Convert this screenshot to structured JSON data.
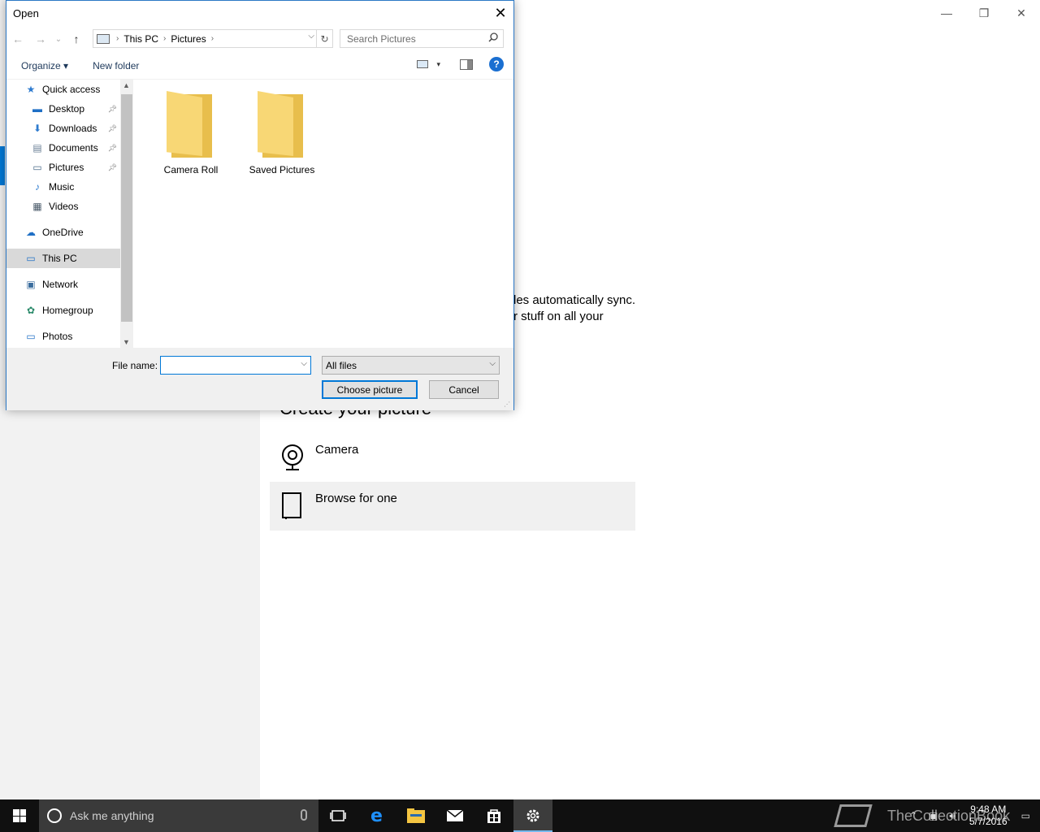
{
  "background": {
    "sync_text_line1": "les automatically sync.",
    "sync_text_line2": "r stuff on all your",
    "create_heading": "Create your picture",
    "options": [
      {
        "label": "Camera",
        "icon": "camera-icon"
      },
      {
        "label": "Browse for one",
        "icon": "browse-icon"
      }
    ],
    "window_controls": {
      "minimize": "—",
      "restore": "❐",
      "close": "✕"
    }
  },
  "dialog": {
    "title": "Open",
    "close_glyph": "✕",
    "address": {
      "crumbs": [
        "This PC",
        "Pictures"
      ],
      "separator": "›",
      "dropdown_glyph": "⌵",
      "refresh_glyph": "↻"
    },
    "search": {
      "placeholder": "Search Pictures",
      "icon": "search-icon"
    },
    "nav_buttons": {
      "back": "←",
      "forward": "→",
      "recent": "⌄",
      "up": "↑"
    },
    "toolbar": {
      "organize": "Organize ▾",
      "new_folder": "New folder",
      "view_dd": "▾",
      "help": "?"
    },
    "nav_pane": [
      {
        "label": "Quick access",
        "icon": "star-icon",
        "glyph": "★",
        "color": "#2e7bcf",
        "indent": 0,
        "pinned": false,
        "selected": false
      },
      {
        "label": "Desktop",
        "icon": "desktop-icon",
        "glyph": "▬",
        "color": "#1f6fc5",
        "indent": 1,
        "pinned": true,
        "selected": false
      },
      {
        "label": "Downloads",
        "icon": "downloads-icon",
        "glyph": "⬇",
        "color": "#2e7bcf",
        "indent": 1,
        "pinned": true,
        "selected": false
      },
      {
        "label": "Documents",
        "icon": "documents-icon",
        "glyph": "▤",
        "color": "#6a7f96",
        "indent": 1,
        "pinned": true,
        "selected": false
      },
      {
        "label": "Pictures",
        "icon": "pictures-icon",
        "glyph": "▭",
        "color": "#4a6b8a",
        "indent": 1,
        "pinned": true,
        "selected": false
      },
      {
        "label": "Music",
        "icon": "music-icon",
        "glyph": "♪",
        "color": "#2e7bcf",
        "indent": 1,
        "pinned": false,
        "selected": false
      },
      {
        "label": "Videos",
        "icon": "videos-icon",
        "glyph": "▦",
        "color": "#4a5a6a",
        "indent": 1,
        "pinned": false,
        "selected": false
      },
      {
        "label": "",
        "icon": "",
        "glyph": "",
        "color": "",
        "indent": 0,
        "pinned": false,
        "selected": false,
        "spacer": true
      },
      {
        "label": "OneDrive",
        "icon": "onedrive-icon",
        "glyph": "☁",
        "color": "#1f6fc5",
        "indent": 0,
        "pinned": false,
        "selected": false
      },
      {
        "label": "",
        "icon": "",
        "glyph": "",
        "color": "",
        "indent": 0,
        "pinned": false,
        "selected": false,
        "spacer": true
      },
      {
        "label": "This PC",
        "icon": "this-pc-icon",
        "glyph": "▭",
        "color": "#1f6fc5",
        "indent": 0,
        "pinned": false,
        "selected": true
      },
      {
        "label": "",
        "icon": "",
        "glyph": "",
        "color": "",
        "indent": 0,
        "pinned": false,
        "selected": false,
        "spacer": true
      },
      {
        "label": "Network",
        "icon": "network-icon",
        "glyph": "▣",
        "color": "#3c6e9e",
        "indent": 0,
        "pinned": false,
        "selected": false
      },
      {
        "label": "",
        "icon": "",
        "glyph": "",
        "color": "",
        "indent": 0,
        "pinned": false,
        "selected": false,
        "spacer": true
      },
      {
        "label": "Homegroup",
        "icon": "homegroup-icon",
        "glyph": "✿",
        "color": "#2a8a6a",
        "indent": 0,
        "pinned": false,
        "selected": false
      },
      {
        "label": "",
        "icon": "",
        "glyph": "",
        "color": "",
        "indent": 0,
        "pinned": false,
        "selected": false,
        "spacer": true
      },
      {
        "label": "Photos",
        "icon": "photos-icon",
        "glyph": "▭",
        "color": "#1f6fc5",
        "indent": 0,
        "pinned": false,
        "selected": false
      }
    ],
    "files": [
      {
        "name": "Camera Roll",
        "icon": "folder-icon"
      },
      {
        "name": "Saved Pictures",
        "icon": "folder-icon"
      }
    ],
    "file_name_label": "File name:",
    "file_name_value": "",
    "filter_value": "All files",
    "choose_button": "Choose picture",
    "cancel_button": "Cancel"
  },
  "taskbar": {
    "search_placeholder": "Ask me anything",
    "time": "9:48 AM",
    "date": "5/7/2016",
    "watermark": "TheCollectionBook",
    "apps": [
      "task-view-icon",
      "edge-icon",
      "file-explorer-icon",
      "mail-icon",
      "store-icon",
      "settings-icon"
    ]
  },
  "colors": {
    "accent": "#0078d7",
    "folder": "#f8d775",
    "taskbar": "#101010"
  }
}
